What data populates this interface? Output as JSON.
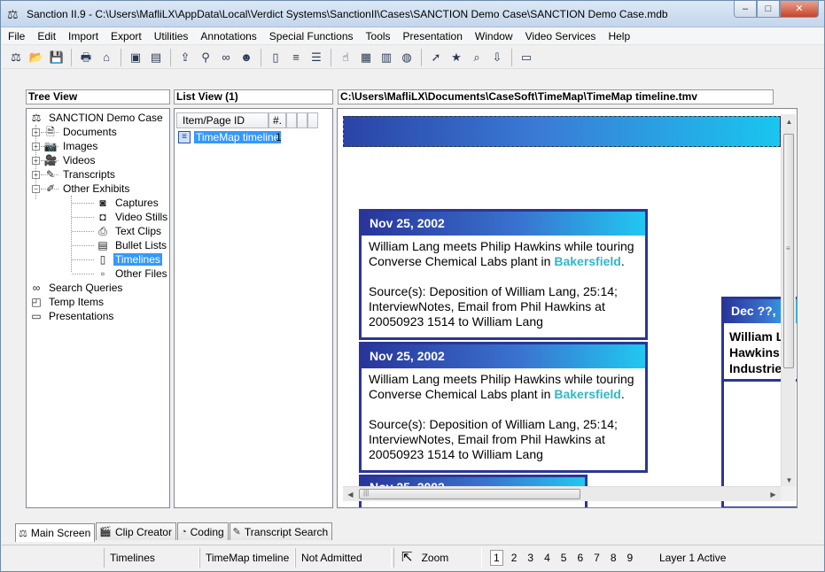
{
  "window": {
    "title": "Sanction II.9 - C:\\Users\\MafliLX\\AppData\\Local\\Verdict Systems\\SanctionII\\Cases\\SANCTION Demo Case\\SANCTION Demo Case.mdb",
    "app_icon": "scales-icon",
    "minimize": "–",
    "maximize": "□",
    "close": "✕"
  },
  "menu": [
    "File",
    "Edit",
    "Import",
    "Export",
    "Utilities",
    "Annotations",
    "Special Functions",
    "Tools",
    "Presentation",
    "Window",
    "Video Services",
    "Help"
  ],
  "toolbar": {
    "groups": [
      [
        "new-case-icon",
        "open-folder-icon",
        "save-icon"
      ],
      [
        "print-icon",
        "scan-icon"
      ],
      [
        "exhibit-a-icon",
        "exhibit-b-icon"
      ],
      [
        "import-icon",
        "search-icon",
        "binoculars-icon",
        "people-icon"
      ],
      [
        "document-icon",
        "text-clip-icon",
        "bullet-list-icon"
      ],
      [
        "hand-icon",
        "film-icon",
        "layout-icon",
        "globe-icon"
      ],
      [
        "pointer-icon",
        "folder-star-icon",
        "folder-search-icon",
        "export-icon"
      ],
      [
        "presentation-icon"
      ]
    ],
    "glyphs": {
      "new-case-icon": "⚖",
      "open-folder-icon": "📂",
      "save-icon": "💾",
      "print-icon": "🖶",
      "scan-icon": "⌂",
      "exhibit-a-icon": "▣",
      "exhibit-b-icon": "▤",
      "import-icon": "⇪",
      "search-icon": "⚲",
      "binoculars-icon": "∞",
      "people-icon": "☻",
      "document-icon": "▯",
      "text-clip-icon": "≡",
      "bullet-list-icon": "☰",
      "hand-icon": "☝",
      "film-icon": "▦",
      "layout-icon": "▥",
      "globe-icon": "◍",
      "pointer-icon": "➚",
      "folder-star-icon": "★",
      "folder-search-icon": "⌕",
      "export-icon": "⇩",
      "presentation-icon": "▭"
    }
  },
  "panes": {
    "tree_header": "Tree View",
    "list_header": "List View (1)",
    "viewer_path": "C:\\Users\\MafliLX\\Documents\\CaseSoft\\TimeMap\\TimeMap timeline.tmv"
  },
  "tree": {
    "root": "SANCTION Demo Case",
    "items": [
      {
        "label": "Documents",
        "icon": "documents-icon",
        "glyph": "🗎",
        "expander": "+"
      },
      {
        "label": "Images",
        "icon": "camera-icon",
        "glyph": "📷",
        "expander": "+"
      },
      {
        "label": "Videos",
        "icon": "video-camera-icon",
        "glyph": "🎥",
        "expander": "+"
      },
      {
        "label": "Transcripts",
        "icon": "transcript-icon",
        "glyph": "✎",
        "expander": "+"
      },
      {
        "label": "Other Exhibits",
        "icon": "other-exhibits-icon",
        "glyph": "✐",
        "expander": "−"
      }
    ],
    "children": [
      {
        "label": "Captures",
        "icon": "capture-icon",
        "glyph": "◙"
      },
      {
        "label": "Video Stills",
        "icon": "video-still-icon",
        "glyph": "◘"
      },
      {
        "label": "Text Clips",
        "icon": "text-clip-icon",
        "glyph": "⎙"
      },
      {
        "label": "Bullet Lists",
        "icon": "bullet-list-icon",
        "glyph": "▤"
      },
      {
        "label": "Timelines",
        "icon": "timeline-icon",
        "glyph": "▯",
        "selected": true
      },
      {
        "label": "Other Files",
        "icon": "other-files-icon",
        "glyph": "▫"
      }
    ],
    "extras": [
      {
        "label": "Search Queries",
        "icon": "search-queries-icon",
        "glyph": "∞"
      },
      {
        "label": "Temp Items",
        "icon": "temp-items-icon",
        "glyph": "◰"
      },
      {
        "label": "Presentations",
        "icon": "presentations-icon",
        "glyph": "▭"
      }
    ]
  },
  "list": {
    "columns": [
      "Item/Page ID",
      "#."
    ],
    "rows": [
      {
        "label": "TimeMap timeline",
        "num": "1"
      }
    ]
  },
  "timeline": {
    "cards": [
      {
        "date": "Nov 25, 2002",
        "text_before": "William Lang meets Philip Hawkins while touring Converse Chemical Labs plant in ",
        "highlight": "Bakersfield",
        "text_after": ".",
        "source": "Source(s): Deposition of William Lang, 25:14; InterviewNotes, Email from Phil Hawkins at 20050923 1514 to William Lang"
      },
      {
        "date": "Nov 25, 2002",
        "text_before": "William Lang meets Philip Hawkins while touring Converse Chemical Labs plant in ",
        "highlight": "Bakersfield",
        "text_after": ".",
        "source": "Source(s): Deposition of William Lang, 25:14; InterviewNotes, Email from Phil Hawkins at 20050923 1514 to William Lang"
      }
    ],
    "partial_card_date": "Nov 25, 2002",
    "right_card": {
      "date": "Dec ??,",
      "lines": [
        "William L",
        "Hawkins",
        "Industrie"
      ]
    }
  },
  "tabs": [
    {
      "label": "Main Screen",
      "icon": "scales-icon",
      "glyph": "⚖",
      "active": true
    },
    {
      "label": "Clip Creator",
      "icon": "clip-creator-icon",
      "glyph": "🎬",
      "active": false
    },
    {
      "label": "Coding",
      "icon": "coding-icon",
      "glyph": "◔",
      "active": false
    },
    {
      "label": "Transcript Search",
      "icon": "transcript-search-icon",
      "glyph": "✎",
      "active": false
    }
  ],
  "status": {
    "category": "Timelines",
    "item": "TimeMap timeline",
    "admission": "Not Admitted",
    "tool": "Zoom",
    "pages": [
      "1",
      "2",
      "3",
      "4",
      "5",
      "6",
      "7",
      "8",
      "9"
    ],
    "active_page": "1",
    "layer": "Layer 1 Active"
  }
}
